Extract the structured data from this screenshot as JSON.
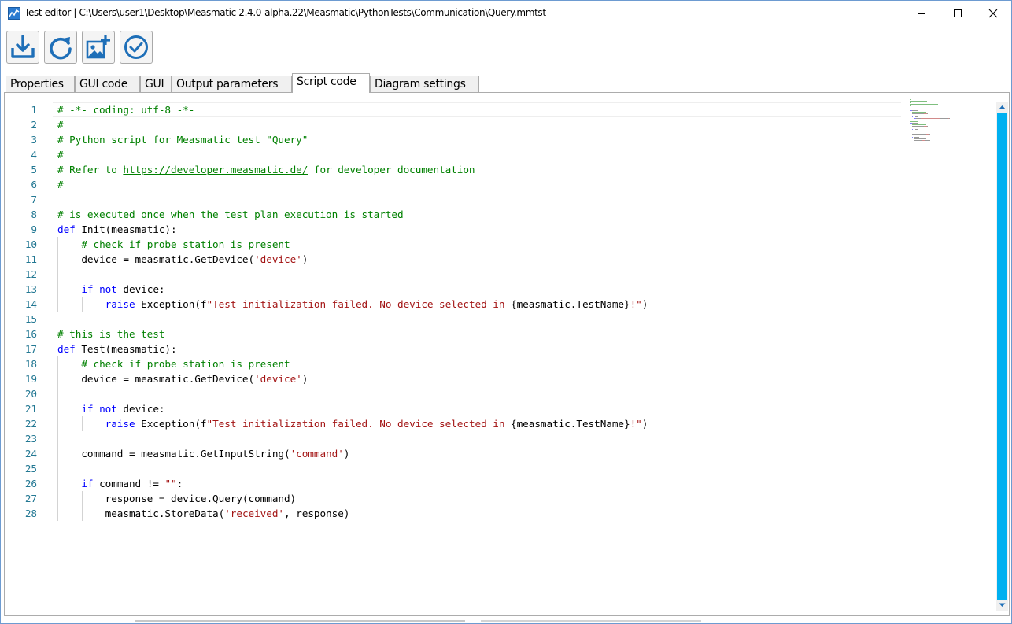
{
  "window": {
    "title": "Test editor | C:\\Users\\user1\\Desktop\\Measmatic 2.4.0-alpha.22\\Measmatic\\PythonTests\\Communication\\Query.mmtst",
    "app_icon": "measmatic-chart-icon",
    "controls": [
      "minimize-icon",
      "maximize-icon",
      "close-icon"
    ]
  },
  "toolbar": {
    "buttons": [
      {
        "icon": "save-download-icon"
      },
      {
        "icon": "refresh-icon"
      },
      {
        "icon": "add-image-icon"
      },
      {
        "icon": "check-circle-icon"
      }
    ],
    "accent_color": "#1e6fb8"
  },
  "tabs": [
    {
      "label": "Properties",
      "active": false
    },
    {
      "label": "GUI code",
      "active": false
    },
    {
      "label": "GUI",
      "active": false
    },
    {
      "label": "Output parameters",
      "active": false
    },
    {
      "label": "Script code",
      "active": true
    },
    {
      "label": "Diagram settings",
      "active": false
    }
  ],
  "editor": {
    "language": "python",
    "current_line": 1,
    "colors": {
      "comment": "#008000",
      "keyword": "#0000ff",
      "string": "#a31515",
      "line_number": "#237893"
    },
    "lines": [
      [
        [
          "c",
          "# -*- coding: utf-8 -*-"
        ]
      ],
      [
        [
          "c",
          "#"
        ]
      ],
      [
        [
          "c",
          "# Python script for Measmatic test \"Query\""
        ]
      ],
      [
        [
          "c",
          "#"
        ]
      ],
      [
        [
          "c",
          "# Refer to "
        ],
        [
          "l",
          "https://developer.measmatic.de/"
        ],
        [
          "c",
          " for developer documentation"
        ]
      ],
      [
        [
          "c",
          "#"
        ]
      ],
      [],
      [
        [
          "c",
          "# is executed once when the test plan execution is started"
        ]
      ],
      [
        [
          "k",
          "def"
        ],
        [
          "t",
          " Init(measmatic):"
        ]
      ],
      [
        [
          "t",
          "    "
        ],
        [
          "c",
          "# check if probe station is present"
        ]
      ],
      [
        [
          "t",
          "    device = measmatic.GetDevice("
        ],
        [
          "s",
          "'device'"
        ],
        [
          "t",
          ")"
        ]
      ],
      [],
      [
        [
          "t",
          "    "
        ],
        [
          "k",
          "if"
        ],
        [
          "t",
          " "
        ],
        [
          "k",
          "not"
        ],
        [
          "t",
          " device:"
        ]
      ],
      [
        [
          "t",
          "        "
        ],
        [
          "k",
          "raise"
        ],
        [
          "t",
          " Exception(f"
        ],
        [
          "s",
          "\"Test initialization failed. No device selected in "
        ],
        [
          "t",
          "{measmatic.TestName}"
        ],
        [
          "s",
          "!\""
        ],
        [
          "t",
          ")"
        ]
      ],
      [],
      [
        [
          "c",
          "# this is the test"
        ]
      ],
      [
        [
          "k",
          "def"
        ],
        [
          "t",
          " Test(measmatic):"
        ]
      ],
      [
        [
          "t",
          "    "
        ],
        [
          "c",
          "# check if probe station is present"
        ]
      ],
      [
        [
          "t",
          "    device = measmatic.GetDevice("
        ],
        [
          "s",
          "'device'"
        ],
        [
          "t",
          ")"
        ]
      ],
      [],
      [
        [
          "t",
          "    "
        ],
        [
          "k",
          "if"
        ],
        [
          "t",
          " "
        ],
        [
          "k",
          "not"
        ],
        [
          "t",
          " device:"
        ]
      ],
      [
        [
          "t",
          "        "
        ],
        [
          "k",
          "raise"
        ],
        [
          "t",
          " Exception(f"
        ],
        [
          "s",
          "\"Test initialization failed. No device selected in "
        ],
        [
          "t",
          "{measmatic.TestName}"
        ],
        [
          "s",
          "!\""
        ],
        [
          "t",
          ")"
        ]
      ],
      [],
      [
        [
          "t",
          "    command = measmatic.GetInputString("
        ],
        [
          "s",
          "'command'"
        ],
        [
          "t",
          ")"
        ]
      ],
      [],
      [
        [
          "t",
          "    "
        ],
        [
          "k",
          "if"
        ],
        [
          "t",
          " command != "
        ],
        [
          "s",
          "\"\""
        ],
        [
          "t",
          ":"
        ]
      ],
      [
        [
          "t",
          "        response = device.Query(command)"
        ]
      ],
      [
        [
          "t",
          "        measmatic.StoreData("
        ],
        [
          "s",
          "'received'"
        ],
        [
          "t",
          ", response)"
        ]
      ]
    ]
  },
  "scrollbar": {
    "color": "#00b0f0"
  }
}
